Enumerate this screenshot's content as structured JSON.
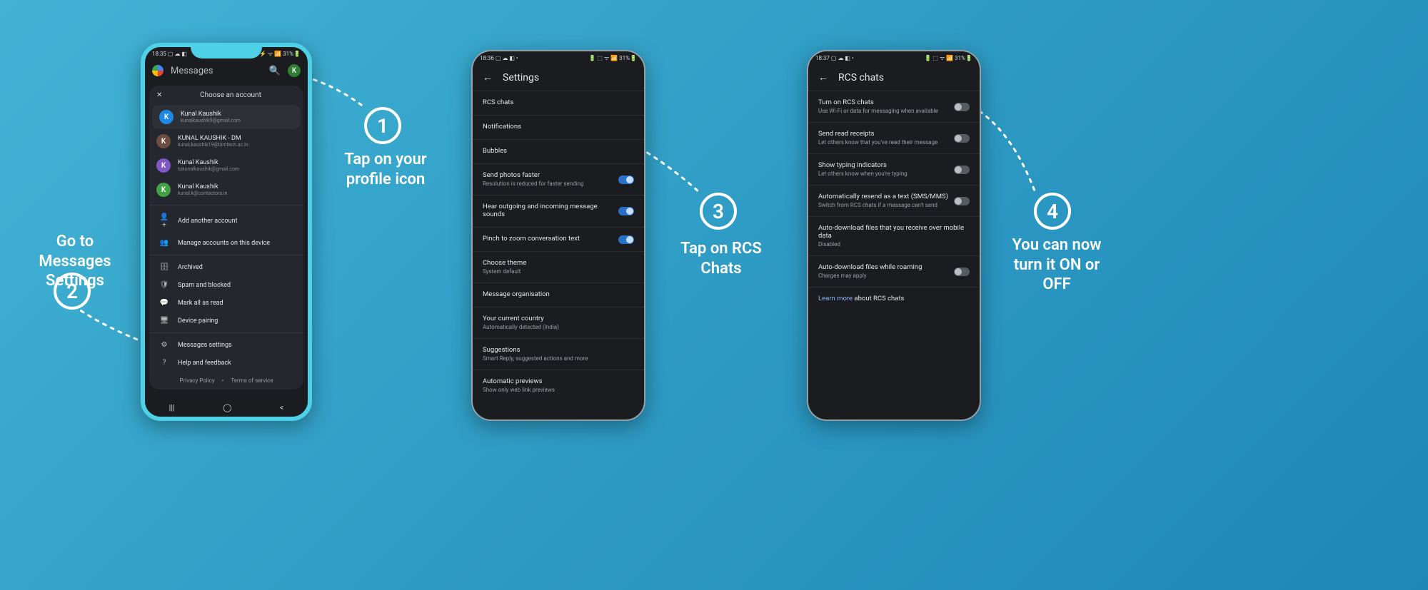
{
  "status": {
    "time1": "18:35",
    "time2": "18:36",
    "time3": "18:37",
    "iconsLeft": "▢ ☁ ◧",
    "iconsLeftDots": "▢ ☁ ◧ •",
    "right": "⚡ ᯤ 📶 31%🔋",
    "rightAlt": "🔋 ⬚ ᯤ 📶 31%🔋"
  },
  "phone1": {
    "app": "Messages",
    "avatarLetter": "K",
    "chooseAccount": "Choose an account",
    "close": "✕",
    "accounts": [
      {
        "name": "Kunal Kaushik",
        "email": "kunalkaushik9@gmail.com",
        "color": "#1e88e5",
        "letter": "K"
      },
      {
        "name": "KUNAL KAUSHIK - DM",
        "email": "kunal.kaushik19@bimtech.ac.in",
        "color": "#6d4c41",
        "letter": "K"
      },
      {
        "name": "Kunal Kaushik",
        "email": "tokunalkaushik@gmail.com",
        "color": "#7e57c2",
        "letter": "K"
      },
      {
        "name": "Kunal Kaushik",
        "email": "kunal.k@contactora.in",
        "color": "#43a047",
        "letter": "K"
      }
    ],
    "addAccount": "Add another account",
    "manageAccounts": "Manage accounts on this device",
    "archived": "Archived",
    "spam": "Spam and blocked",
    "markRead": "Mark all as read",
    "devicePairing": "Device pairing",
    "messagesSettings": "Messages settings",
    "help": "Help and feedback",
    "privacy": "Privacy Policy",
    "dot": "•",
    "terms": "Terms of service"
  },
  "phone2": {
    "title": "Settings",
    "items": [
      {
        "title": "RCS chats",
        "sub": "",
        "toggle": null
      },
      {
        "title": "Notifications",
        "sub": "",
        "toggle": null
      },
      {
        "title": "Bubbles",
        "sub": "",
        "toggle": null
      },
      {
        "title": "Send photos faster",
        "sub": "Resolution is reduced for faster sending",
        "toggle": "on"
      },
      {
        "title": "Hear outgoing and incoming message sounds",
        "sub": "",
        "toggle": "on"
      },
      {
        "title": "Pinch to zoom conversation text",
        "sub": "",
        "toggle": "on"
      },
      {
        "title": "Choose theme",
        "sub": "System default",
        "toggle": null
      },
      {
        "title": "Message organisation",
        "sub": "",
        "toggle": null
      },
      {
        "title": "Your current country",
        "sub": "Automatically detected (India)",
        "toggle": null
      },
      {
        "title": "Suggestions",
        "sub": "Smart Reply, suggested actions and more",
        "toggle": null
      },
      {
        "title": "Automatic previews",
        "sub": "Show only web link previews",
        "toggle": null
      }
    ]
  },
  "phone3": {
    "title": "RCS chats",
    "items": [
      {
        "title": "Turn on RCS chats",
        "sub": "Use Wi-Fi or data for messaging when available",
        "toggle": "off"
      },
      {
        "title": "Send read receipts",
        "sub": "Let others know that you've read their message",
        "toggle": "off"
      },
      {
        "title": "Show typing indicators",
        "sub": "Let others know when you're typing",
        "toggle": "off"
      },
      {
        "title": "Automatically resend as a text (SMS/MMS)",
        "sub": "Switch from RCS chats if a message can't send",
        "toggle": "off"
      },
      {
        "title": "Auto-download files that you receive over mobile data",
        "sub": "Disabled",
        "toggle": null
      },
      {
        "title": "Auto-download files while roaming",
        "sub": "Charges may apply",
        "toggle": "off"
      },
      {
        "title": "Learn more about RCS chats",
        "sub": "",
        "toggle": null,
        "link": true
      }
    ]
  },
  "annotations": {
    "step1": "1",
    "label1": "Tap on your\nprofile icon",
    "step2": "2",
    "label2": "Go to\nMessages Settings",
    "step3": "3",
    "label3": "Tap on RCS Chats",
    "step4": "4",
    "label4": "You can now\nturn it ON or OFF"
  },
  "icons": {
    "search": "🔍",
    "back": "←",
    "addPerson": "👤+",
    "manage": "👥",
    "archive": "🗄",
    "shield": "🛡",
    "chat": "💬",
    "devices": "🖥",
    "gear": "⚙",
    "help": "?"
  }
}
